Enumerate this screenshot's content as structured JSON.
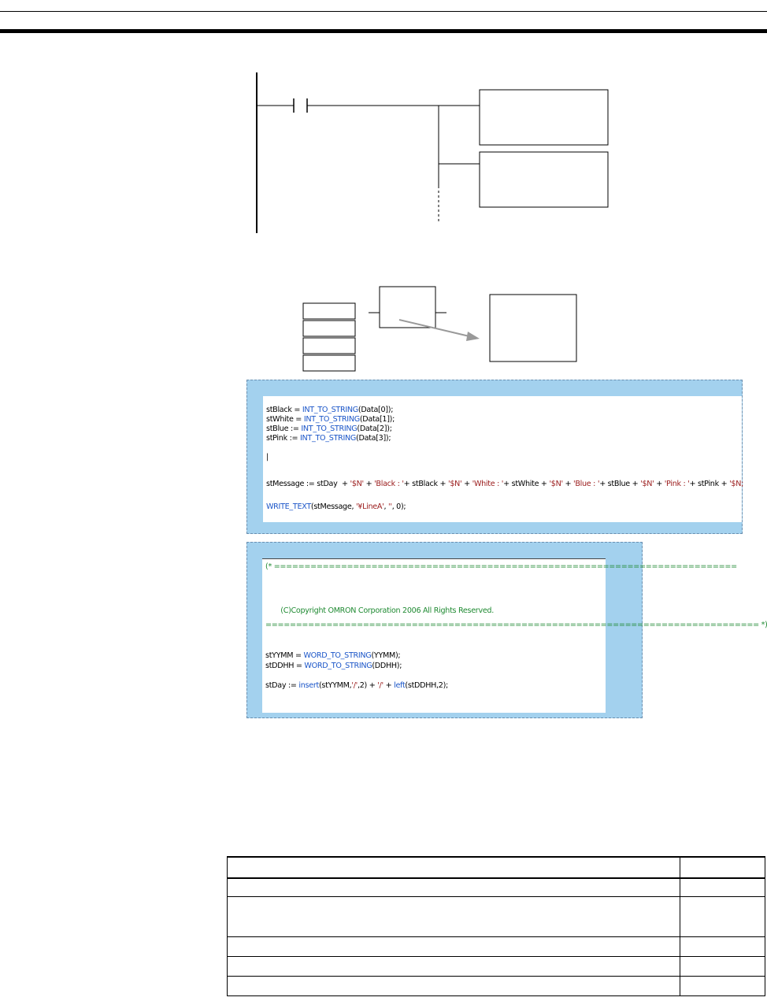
{
  "code_block_1": {
    "lines": [
      [
        {
          "t": "stBlack",
          "c": ""
        },
        {
          "t": " = ",
          "c": ""
        },
        {
          "t": "INT_TO_STRING",
          "c": "kw"
        },
        {
          "t": "(Data[0]);",
          "c": ""
        }
      ],
      [
        {
          "t": "stWhite",
          "c": ""
        },
        {
          "t": " = ",
          "c": ""
        },
        {
          "t": "INT_TO_STRING",
          "c": "kw"
        },
        {
          "t": "(Data[1]);",
          "c": ""
        }
      ],
      [
        {
          "t": "stBlue",
          "c": ""
        },
        {
          "t": " := ",
          "c": ""
        },
        {
          "t": "INT_TO_STRING",
          "c": "kw"
        },
        {
          "t": "(Data[2]);",
          "c": ""
        }
      ],
      [
        {
          "t": "stPink",
          "c": ""
        },
        {
          "t": " := ",
          "c": ""
        },
        {
          "t": "INT_TO_STRING",
          "c": "kw"
        },
        {
          "t": "(Data[3]);",
          "c": ""
        }
      ],
      [
        {
          "t": "|",
          "c": ""
        }
      ],
      [
        {
          "t": "stMessage := stDay  + ",
          "c": ""
        },
        {
          "t": "'$N'",
          "c": "str"
        },
        {
          "t": " + ",
          "c": ""
        },
        {
          "t": "'Black : '",
          "c": "str"
        },
        {
          "t": "+ stBlack + ",
          "c": ""
        },
        {
          "t": "'$N'",
          "c": "str"
        },
        {
          "t": " + ",
          "c": ""
        },
        {
          "t": "'White : '",
          "c": "str"
        },
        {
          "t": "+ stWhite + ",
          "c": ""
        },
        {
          "t": "'$N'",
          "c": "str"
        },
        {
          "t": " + ",
          "c": ""
        },
        {
          "t": "'Blue : '",
          "c": "str"
        },
        {
          "t": "+ stBlue + ",
          "c": ""
        },
        {
          "t": "'$N'",
          "c": "str"
        },
        {
          "t": " + ",
          "c": ""
        },
        {
          "t": "'Pink : '",
          "c": "str"
        },
        {
          "t": "+ stPink + ",
          "c": ""
        },
        {
          "t": "'$N;",
          "c": "str"
        }
      ],
      [
        {
          "t": "WRITE_TEXT",
          "c": "kw"
        },
        {
          "t": "(stMessage, ",
          "c": ""
        },
        {
          "t": "'¥LineA'",
          "c": "str"
        },
        {
          "t": ", ",
          "c": ""
        },
        {
          "t": "''",
          "c": "str"
        },
        {
          "t": ", 0);",
          "c": ""
        }
      ]
    ]
  },
  "code_block_2": {
    "lines": [
      [
        {
          "t": "(* ============================================================================",
          "c": "cm"
        }
      ],
      [
        {
          "t": "       (C)Copyright OMRON Corporation 2006 All Rights Reserved.",
          "c": "cm"
        }
      ],
      [
        {
          "t": "================================================================================= *)",
          "c": "cm"
        }
      ],
      [
        {
          "t": "stYYMM = ",
          "c": ""
        },
        {
          "t": "WORD_TO_STRING",
          "c": "kw"
        },
        {
          "t": "(YYMM);",
          "c": ""
        }
      ],
      [
        {
          "t": "stDDHH = ",
          "c": ""
        },
        {
          "t": "WORD_TO_STRING",
          "c": "kw"
        },
        {
          "t": "(DDHH);",
          "c": ""
        }
      ],
      [
        {
          "t": "stDay := ",
          "c": ""
        },
        {
          "t": "insert",
          "c": "kw"
        },
        {
          "t": "(stYYMM,",
          "c": ""
        },
        {
          "t": "'/'",
          "c": "str"
        },
        {
          "t": ",2) + ",
          "c": ""
        },
        {
          "t": "'/'",
          "c": "str"
        },
        {
          "t": " + ",
          "c": ""
        },
        {
          "t": "left",
          "c": "kw"
        },
        {
          "t": "(stDDHH,2);",
          "c": ""
        }
      ]
    ]
  },
  "table": {
    "rows": [
      [
        "",
        ""
      ],
      [
        "",
        ""
      ],
      [
        "",
        ""
      ],
      [
        "",
        ""
      ],
      [
        "",
        ""
      ],
      [
        "",
        ""
      ]
    ]
  },
  "colors": {
    "frame_bg": "#a3d1ee",
    "keyword": "#1a55c8",
    "string": "#9a1a1a",
    "comment": "#1f8a32"
  }
}
